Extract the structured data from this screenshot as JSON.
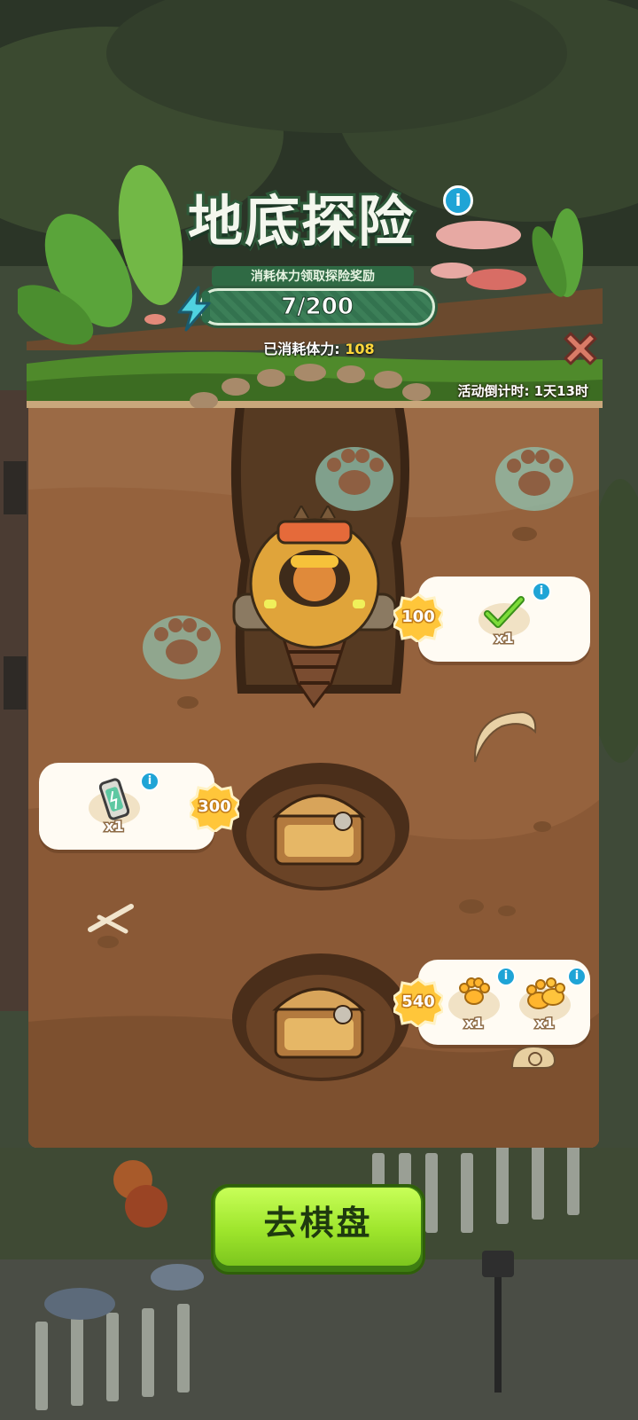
{
  "event": {
    "title": "地底探险",
    "title_suffix": "~",
    "subtitle": "消耗体力领取探险奖励",
    "progress_text": "7/200",
    "progress_current": 7,
    "progress_max": 200,
    "consumed_label": "已消耗体力:",
    "consumed_value": "108",
    "countdown": "活动倒计时: 1天13时"
  },
  "rewards": [
    {
      "threshold": "100",
      "items": [
        {
          "icon": "checkmark-item-icon",
          "qty": "x1",
          "claimed": true
        }
      ]
    },
    {
      "threshold": "300",
      "items": [
        {
          "icon": "battery-item-icon",
          "qty": "x1"
        }
      ]
    },
    {
      "threshold": "540",
      "items": [
        {
          "icon": "gold-paw-icon",
          "qty": "x1"
        },
        {
          "icon": "gold-paw-pile-icon",
          "qty": "x1"
        }
      ]
    }
  ],
  "buttons": {
    "go_board": "去棋盘",
    "info": "i",
    "close": "✕"
  },
  "colors": {
    "dirt": "#9b6a45",
    "accent_green": "#2f6a44",
    "button_green": "#9ee52c",
    "gold": "#ffd83a"
  }
}
